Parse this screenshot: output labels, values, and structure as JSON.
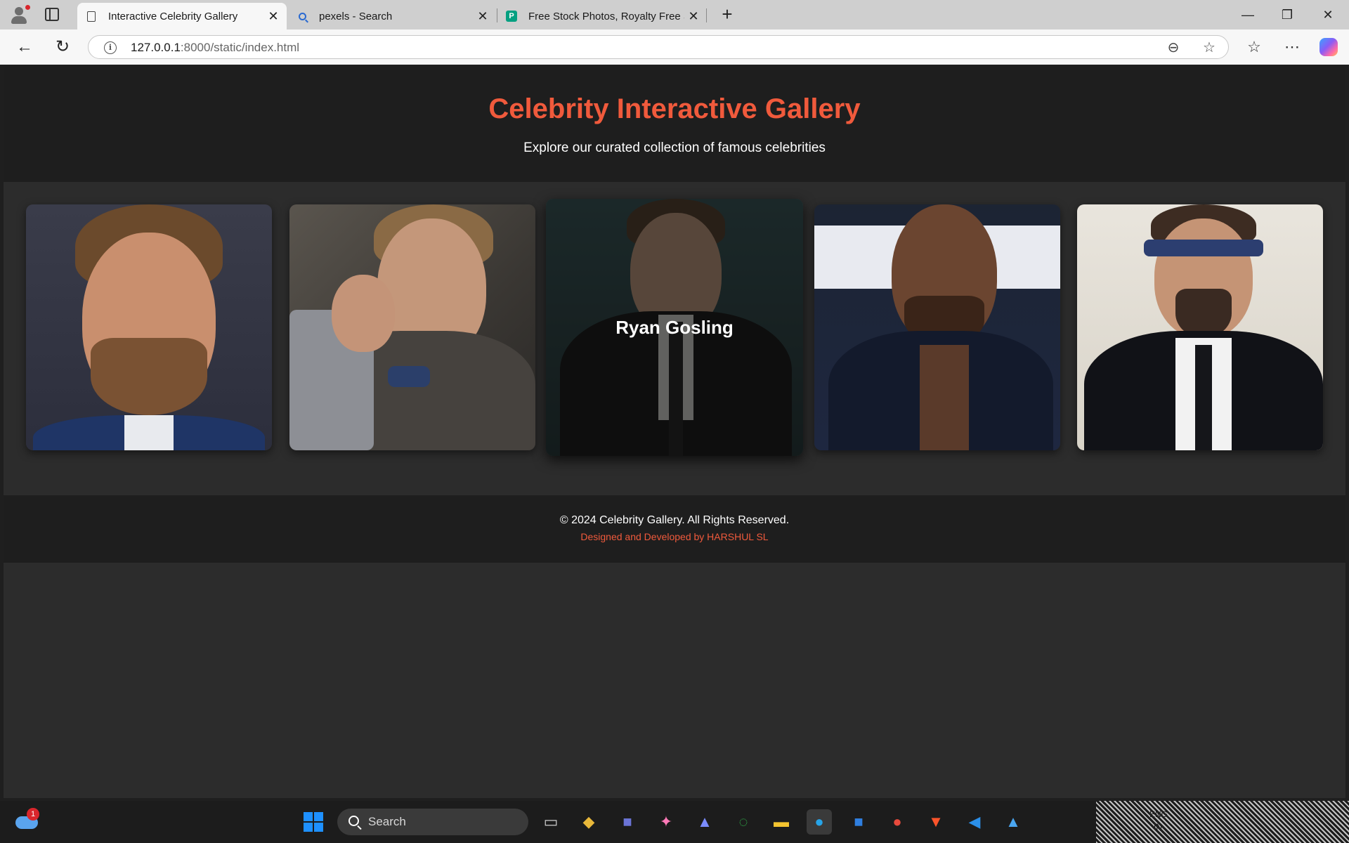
{
  "browser": {
    "tabs": [
      {
        "title": "Interactive Celebrity Gallery",
        "active": true
      },
      {
        "title": "pexels - Search",
        "active": false
      },
      {
        "title": "Free Stock Photos, Royalty Free St",
        "active": false
      }
    ],
    "url_host": "127.0.0.1",
    "url_path": ":8000/static/index.html"
  },
  "page": {
    "title": "Celebrity Interactive Gallery",
    "subtitle": "Explore our curated collection of famous celebrities",
    "accent_color": "#f05a3c",
    "cards": [
      {
        "image": "celebrity-portrait-1",
        "name": "",
        "hovered": false
      },
      {
        "image": "celebrity-portrait-2",
        "name": "",
        "hovered": false
      },
      {
        "image": "celebrity-portrait-3",
        "name": "Ryan Gosling",
        "hovered": true
      },
      {
        "image": "celebrity-portrait-4",
        "name": "",
        "hovered": false
      },
      {
        "image": "celebrity-portrait-5",
        "name": "",
        "hovered": false
      }
    ],
    "footer": {
      "copyright": "© 2024 Celebrity Gallery. All Rights Reserved.",
      "credit": "Designed and Developed by HARSHUL SL"
    }
  },
  "taskbar": {
    "weather_badge": "1",
    "search_label": "Search",
    "tray_lang": "ENG",
    "tray_region": "IN"
  }
}
